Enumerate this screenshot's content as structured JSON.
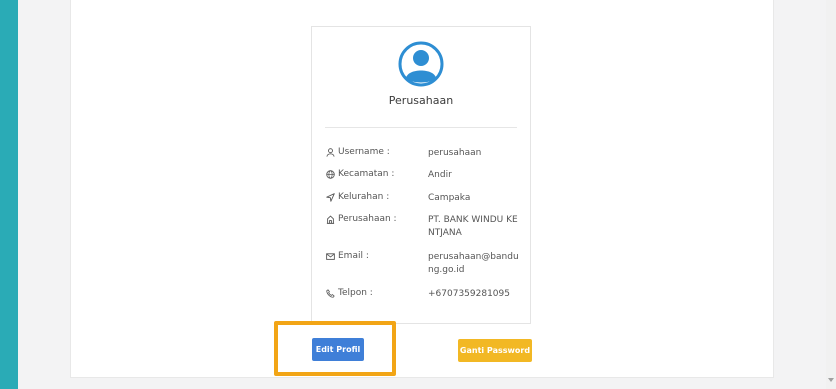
{
  "profile": {
    "name": "Perusahaan",
    "rows": [
      {
        "icon": "user-icon",
        "label": "Username :",
        "value": "perusahaan"
      },
      {
        "icon": "globe-icon",
        "label": "Kecamatan :",
        "value": "Andir"
      },
      {
        "icon": "location-arrow-icon",
        "label": "Kelurahan :",
        "value": "Campaka"
      },
      {
        "icon": "building-icon",
        "label": "Perusahaan :",
        "value": "PT. BANK WINDU KENTJANA"
      },
      {
        "icon": "envelope-icon",
        "label": "Email :",
        "value": "perusahaan@bandung.go.id"
      },
      {
        "icon": "phone-icon",
        "label": "Telpon :",
        "value": "+6707359281095"
      }
    ]
  },
  "actions": {
    "edit_label": "Edit Profil",
    "password_label": "Ganti Password"
  },
  "colors": {
    "background": "#2aabb6",
    "edit_button": "#3f7fd8",
    "password_button": "#f2b824",
    "highlight": "#f2a516",
    "avatar": "#2e8ed3"
  }
}
